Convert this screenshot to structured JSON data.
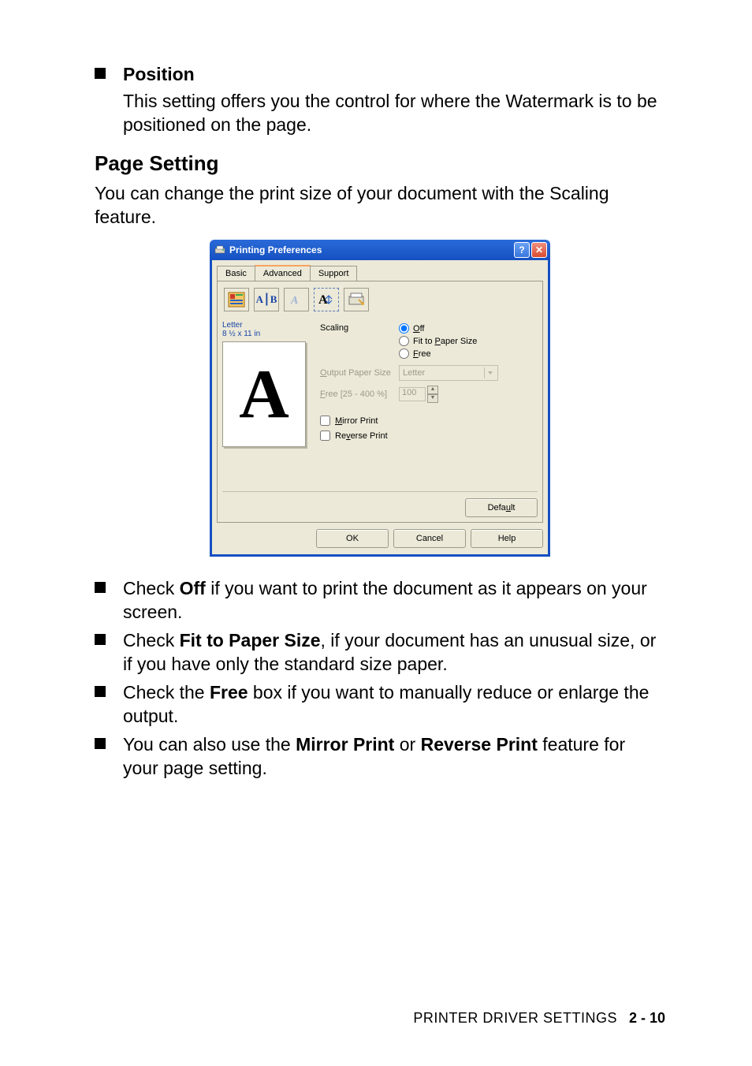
{
  "bullets_top": {
    "position": {
      "title": "Position",
      "desc": "This setting offers you the control for where the Watermark is to be positioned on the page."
    }
  },
  "section": {
    "heading": "Page Setting",
    "intro": "You can change the print size of your document with the Scaling feature."
  },
  "dialog": {
    "title": "Printing Preferences",
    "tabs": {
      "basic": "Basic",
      "advanced": "Advanced",
      "support": "Support"
    },
    "preview": {
      "paper_label1": "Letter",
      "paper_label2": "8 ½ x 11 in",
      "glyph": "A"
    },
    "scaling": {
      "label": "Scaling",
      "opt_off_o": "O",
      "opt_off_rest": "ff",
      "opt_fit_pre": "Fit to ",
      "opt_fit_u": "P",
      "opt_fit_rest": "aper Size",
      "opt_free_f": "F",
      "opt_free_rest": "ree",
      "output_lbl1": "O",
      "output_lbl2": "utput Paper Size",
      "output_val": "Letter",
      "free_lbl_f": "F",
      "free_lbl_rest": "ree [25 - 400 %]",
      "free_val": "100"
    },
    "checks": {
      "mirror_m": "M",
      "mirror_rest": "irror Print",
      "reverse_v": "v",
      "reverse_pre": "Re",
      "reverse_rest": "erse Print"
    },
    "buttons": {
      "default_pre": "Defa",
      "default_u": "u",
      "default_post": "lt",
      "ok": "OK",
      "cancel": "Cancel",
      "help": "Help"
    }
  },
  "bullets_bottom": [
    {
      "pre": "Check ",
      "bold": "Off",
      "post": " if you want to print the document as it appears on your screen."
    },
    {
      "pre": "Check ",
      "bold": "Fit to Paper Size",
      "post": ", if your document has an unusual size, or if you have only the standard size paper."
    },
    {
      "pre": "Check the ",
      "bold": "Free",
      "post": " box if you want to manually reduce or enlarge the output."
    },
    {
      "pre": "You can also use the ",
      "bold": "Mirror Print",
      "mid": " or ",
      "bold2": "Reverse Print",
      "post": " feature for your page setting."
    }
  ],
  "footer": {
    "title": "PRINTER DRIVER SETTINGS",
    "page": "2 - 10"
  }
}
